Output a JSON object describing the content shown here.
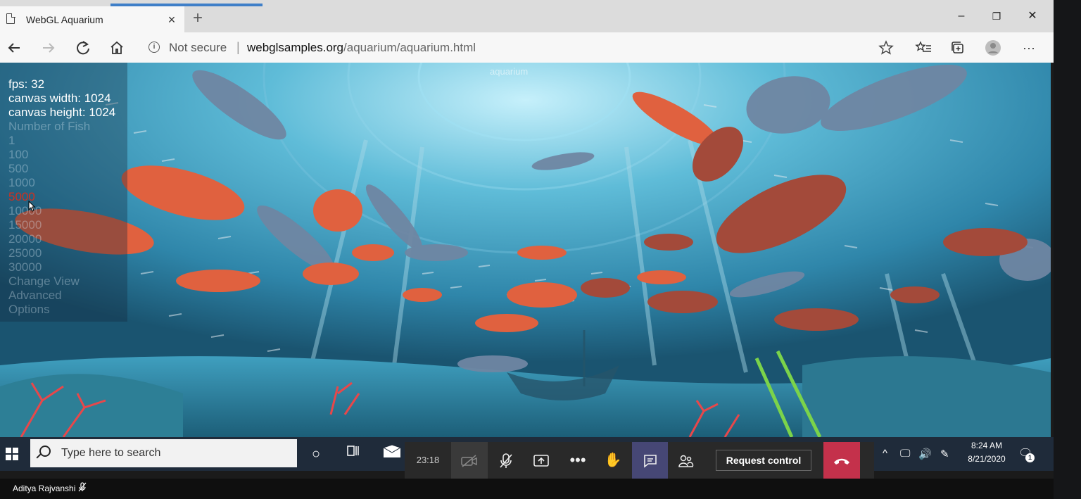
{
  "browser": {
    "tab_title": "WebGL Aquarium",
    "tab_close": "×",
    "new_tab": "+",
    "address": {
      "security_label": "Not secure",
      "url_host": "webglsamples.org",
      "url_path": "/aquarium/aquarium.html"
    },
    "window_controls": {
      "minimize": "–",
      "maximize": "❐",
      "close": "✕"
    }
  },
  "page": {
    "title": "aquarium",
    "hud": {
      "fps": "fps: 32",
      "canvas_width": "canvas width: 1024",
      "canvas_height": "canvas height: 1024",
      "number_of_fish": "Number of Fish",
      "options": [
        "1",
        "100",
        "500",
        "1000",
        "5000",
        "10000",
        "15000",
        "20000",
        "25000",
        "30000"
      ],
      "selected_option": "5000",
      "change_view": "Change View",
      "advanced": "Advanced",
      "options_label": "Options"
    }
  },
  "taskbar": {
    "search_placeholder": "Type here to search"
  },
  "meeting": {
    "timer": "23:18",
    "request_control": "Request control",
    "presenter": "Aditya Rajvanshi"
  },
  "tray": {
    "time": "8:24 AM",
    "date": "8/21/2020",
    "notifications": "1"
  },
  "colors": {
    "water": "#2e7fa6",
    "teams_hangup": "#c4314b",
    "teams_active": "#464775",
    "taskbar": "#1f2b3a"
  }
}
